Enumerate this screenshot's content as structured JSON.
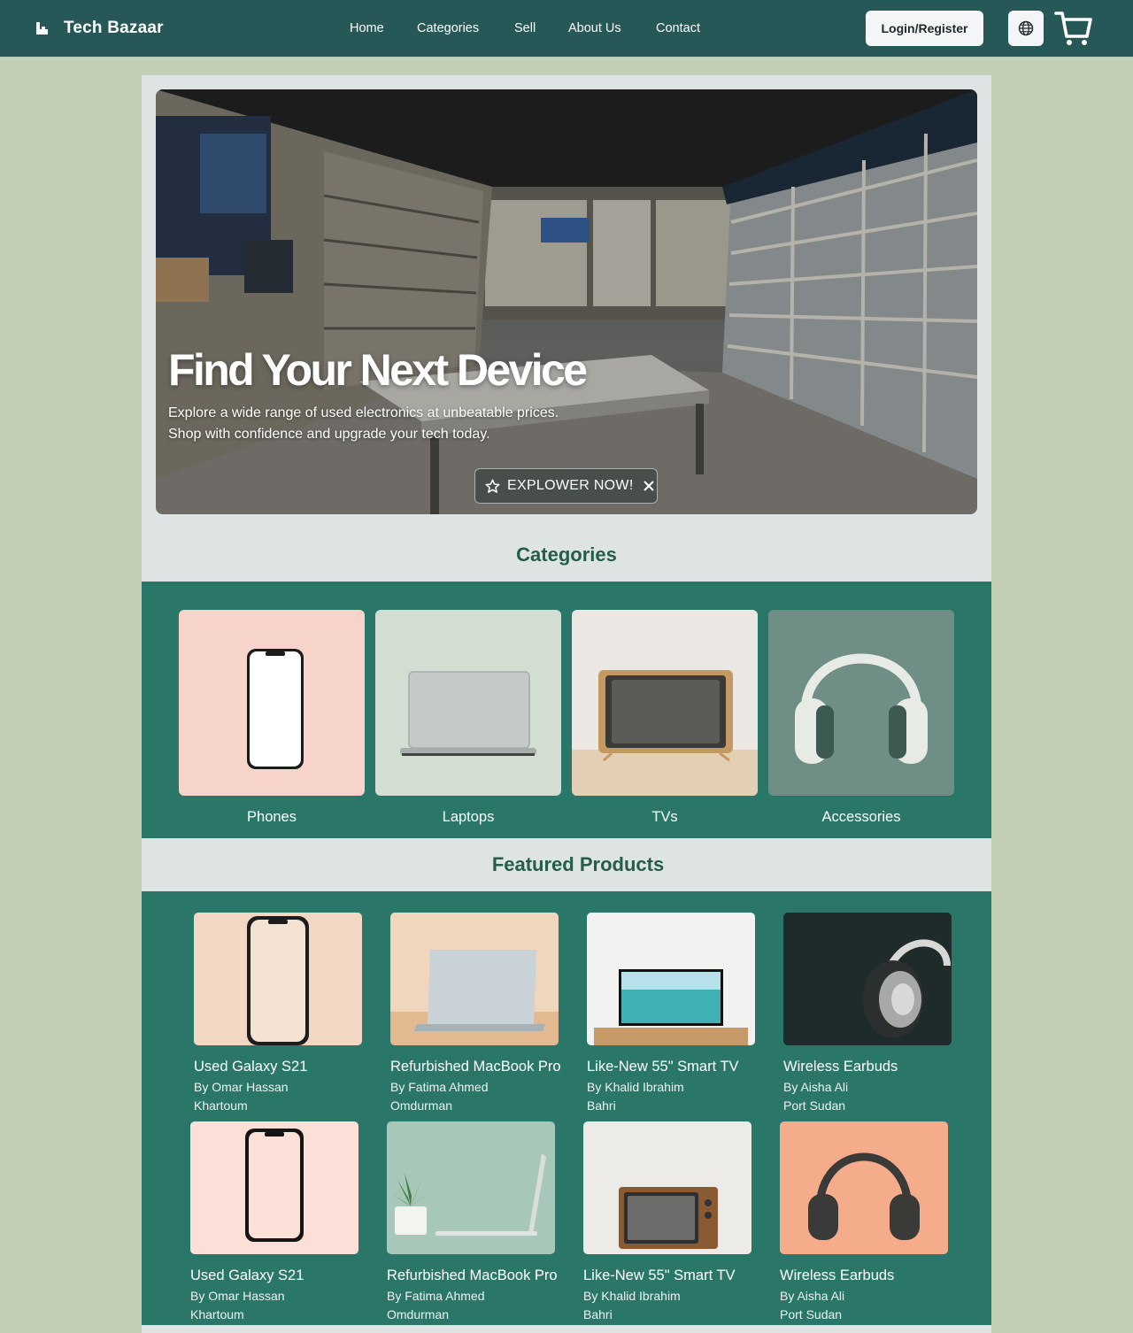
{
  "header": {
    "brand": "Tech Bazaar",
    "nav": [
      "Home",
      "Categories",
      "Sell",
      "About Us",
      "Contact"
    ],
    "login_label": "Login/Register",
    "icons": {
      "logo": "logo-icon",
      "language": "globe-icon",
      "cart": "cart-icon"
    }
  },
  "hero": {
    "title": "Find Your Next Device",
    "line1": "Explore a wide range of used electronics at unbeatable prices.",
    "line2": "Shop with confidence and upgrade your tech today.",
    "cta_label": "EXPLOWER NOW!",
    "cta_icons": [
      "star-icon",
      "close-icon"
    ]
  },
  "categories": {
    "title": "Categories",
    "items": [
      {
        "label": "Phones",
        "image": "phone-image"
      },
      {
        "label": "Laptops",
        "image": "laptop-image"
      },
      {
        "label": "TVs",
        "image": "tv-image"
      },
      {
        "label": "Accessories",
        "image": "headphones-image"
      }
    ]
  },
  "featured": {
    "title": "Featured Products",
    "products": [
      {
        "name": "Used Galaxy S21",
        "seller": "By Omar Hassan",
        "location": "Khartoum"
      },
      {
        "name": "Refurbished MacBook Pro",
        "seller": "By Fatima Ahmed",
        "location": "Omdurman"
      },
      {
        "name": "Like-New 55\" Smart TV",
        "seller": "By Khalid Ibrahim",
        "location": "Bahri"
      },
      {
        "name": "Wireless Earbuds",
        "seller": "By Aisha Ali",
        "location": "Port Sudan"
      },
      {
        "name": "Used Galaxy S21",
        "seller": "By Omar Hassan",
        "location": "Khartoum"
      },
      {
        "name": "Refurbished MacBook Pro",
        "seller": "By Fatima Ahmed",
        "location": "Omdurman"
      },
      {
        "name": "Like-New 55\" Smart TV",
        "seller": "By Khalid Ibrahim",
        "location": "Bahri"
      },
      {
        "name": "Wireless Earbuds",
        "seller": "By Aisha Ali",
        "location": "Port Sudan"
      }
    ]
  },
  "colors": {
    "header_bg": "#255856",
    "page_bg": "#c3cfb5",
    "panel_bg": "#dde4e3",
    "band_bg": "#2a776a",
    "heading": "#255c4c"
  }
}
